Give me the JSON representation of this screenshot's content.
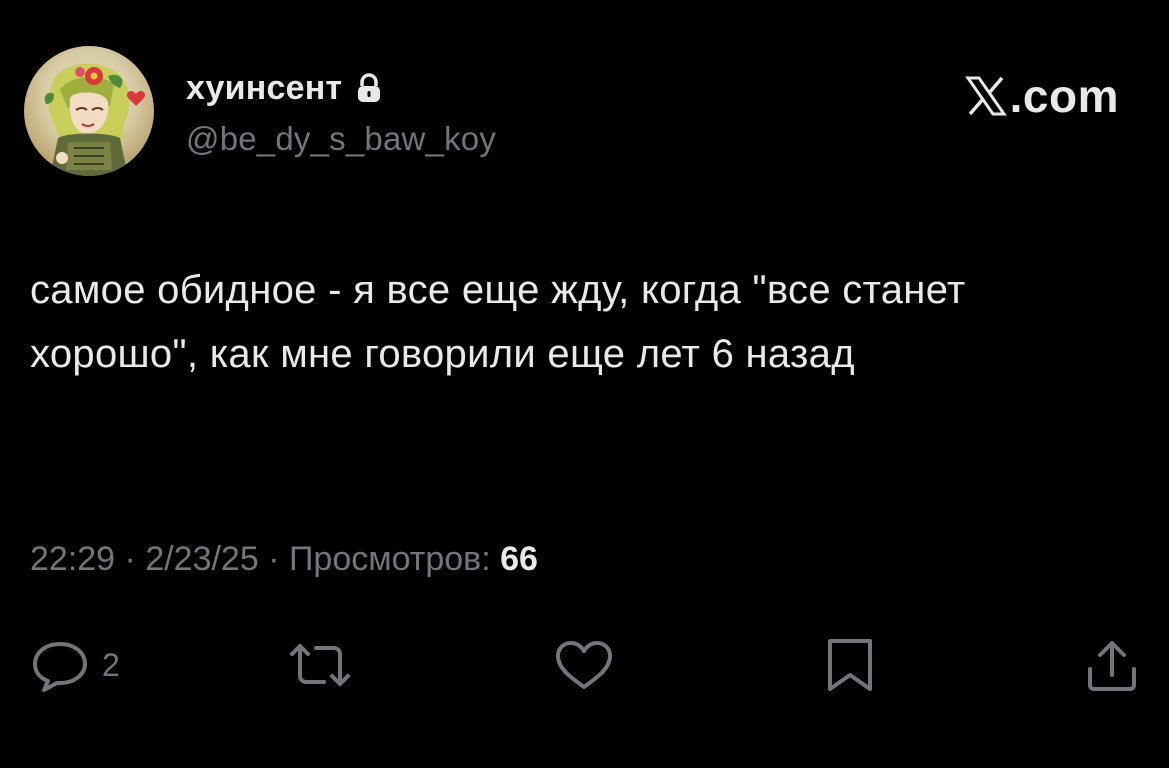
{
  "author": {
    "display_name": "хуинсент",
    "handle": "@be_dy_s_baw_koy",
    "protected_icon": "lock-icon",
    "avatar_icon": "avatar-illustration"
  },
  "brand": {
    "text": ".com",
    "logo_icon": "x-logo-icon"
  },
  "tweet": {
    "text": "самое обидное - я все еще жду, когда \"все станет хорошо\", как мне говорили еще лет 6 назад"
  },
  "meta": {
    "time": "22:29",
    "separator1": " · ",
    "date": "2/23/25",
    "separator2": " · ",
    "views_label": "Просмотров:",
    "views_count": "66"
  },
  "actions": {
    "reply_count": "2",
    "reply_icon": "reply-icon",
    "retweet_icon": "retweet-icon",
    "like_icon": "heart-icon",
    "bookmark_icon": "bookmark-icon",
    "share_icon": "share-icon"
  },
  "colors": {
    "background": "#000000",
    "primary_text": "#e7e9ea",
    "secondary_text": "#71767b"
  }
}
